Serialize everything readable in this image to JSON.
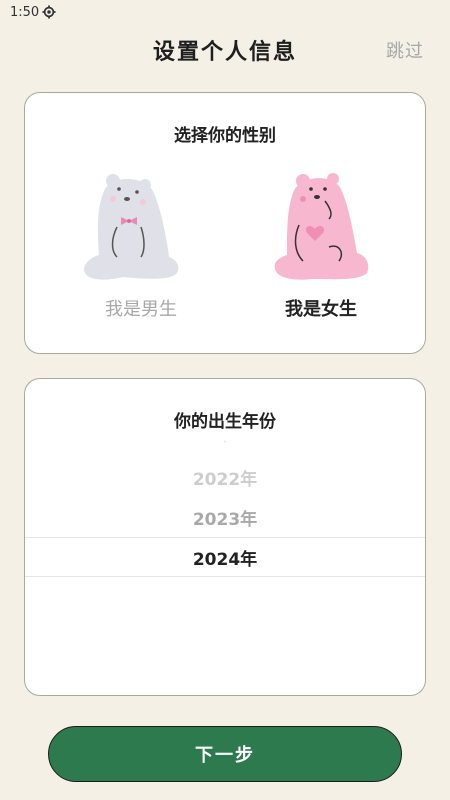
{
  "status_bar": {
    "time": "1:50",
    "settings_icon": "gear-icon"
  },
  "header": {
    "title": "设置个人信息",
    "skip_label": "跳过"
  },
  "gender_card": {
    "title": "选择你的性别",
    "options": [
      {
        "label": "我是男生",
        "icon": "male-bear-icon",
        "selected": false,
        "color": "#dfe0e8"
      },
      {
        "label": "我是女生",
        "icon": "female-bear-icon",
        "selected": true,
        "color": "#f7b8cf"
      }
    ]
  },
  "year_card": {
    "title": "你的出生年份",
    "years": [
      "2022年",
      "2023年",
      "2024年"
    ],
    "selected": "2024年"
  },
  "footer": {
    "next_label": "下一步",
    "accent": "#2e7a4f"
  }
}
